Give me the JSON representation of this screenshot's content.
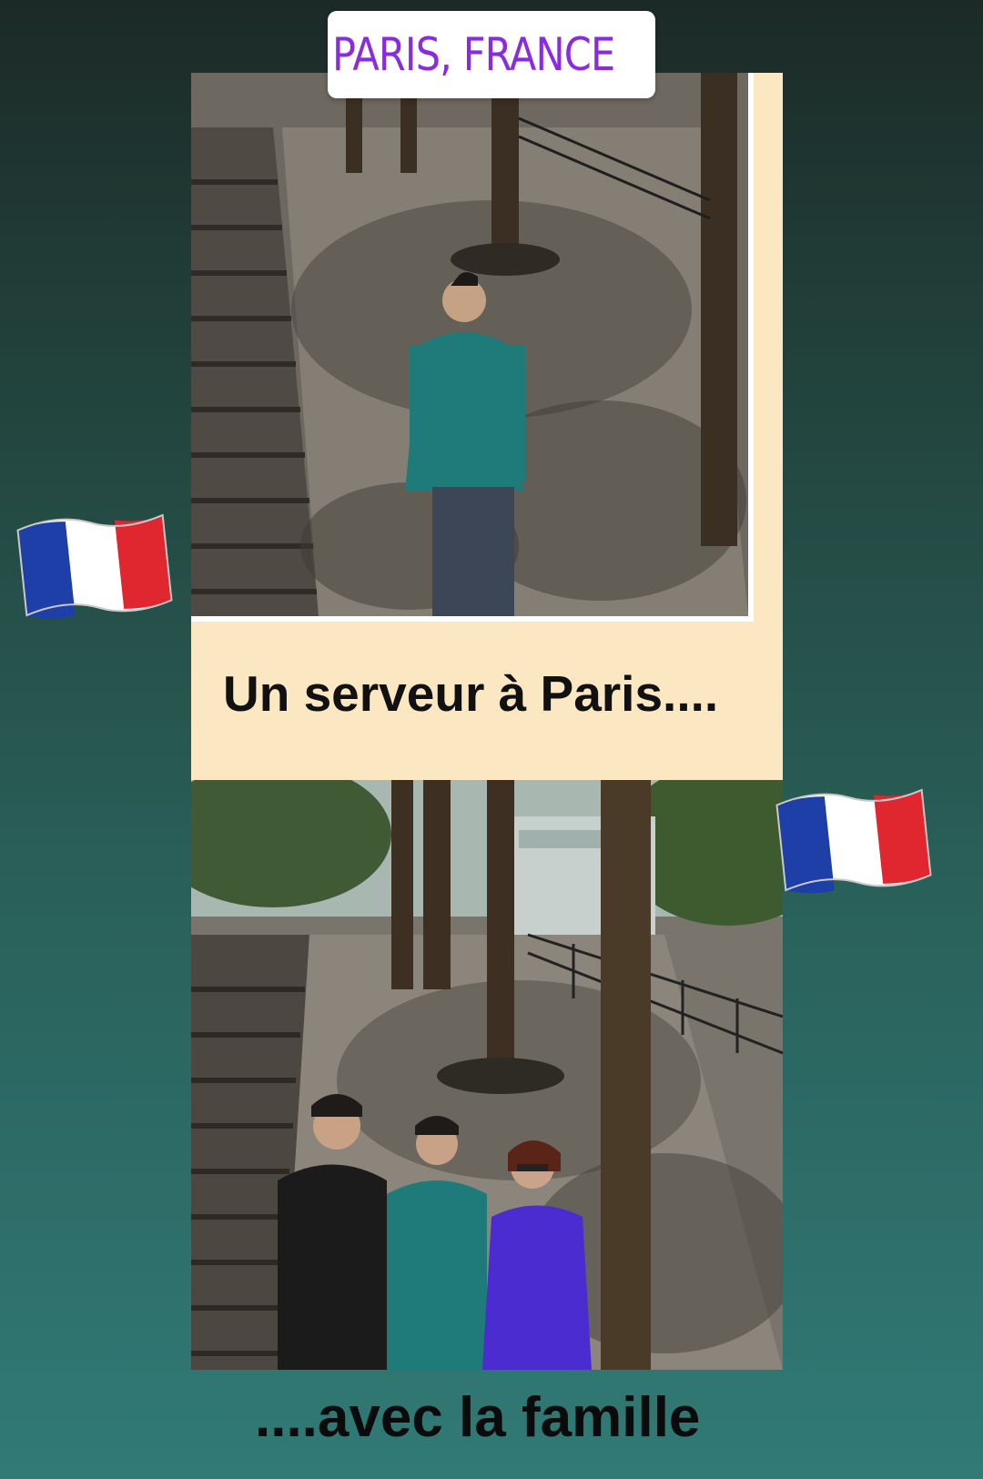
{
  "location_sticker": {
    "text": "PARIS, FRANCE",
    "icon": "location-pin-icon",
    "color": "#8a2be2"
  },
  "captions": {
    "top": "Un serveur à Paris....",
    "bottom": "....avec la famille"
  },
  "photos": [
    {
      "name": "photo-man-on-stairs"
    },
    {
      "name": "photo-family-on-stairs"
    }
  ],
  "stickers": [
    {
      "name": "french-flag-sticker-left",
      "icon": "french-flag-icon"
    },
    {
      "name": "french-flag-sticker-right",
      "icon": "french-flag-icon"
    }
  ],
  "colors": {
    "panel_background": "#fbe7c2",
    "flag_blue": "#1f3fa8",
    "flag_white": "#ffffff",
    "flag_red": "#e0262f"
  }
}
